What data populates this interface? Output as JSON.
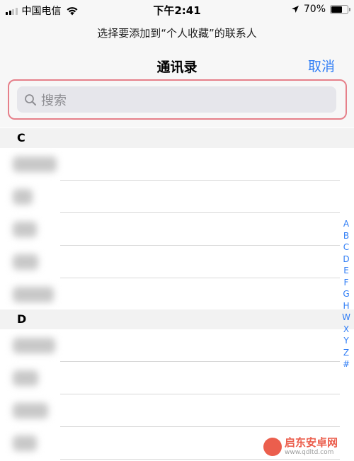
{
  "status_bar": {
    "carrier": "中国电信",
    "time": "下午2:41",
    "battery": "70%",
    "battery_level": 0.7
  },
  "header": {
    "prompt": "选择要添加到“个人收藏”的联系人",
    "title": "通讯录",
    "cancel_label": "取消"
  },
  "search": {
    "placeholder": "搜索"
  },
  "sections": [
    {
      "letter": "C",
      "rows": 5
    },
    {
      "letter": "D",
      "rows": 4
    }
  ],
  "index": [
    "A",
    "B",
    "C",
    "D",
    "E",
    "F",
    "G",
    "H",
    "W",
    "X",
    "Y",
    "Z",
    "#"
  ],
  "watermark": {
    "title": "启东安卓网",
    "url": "www.qdltd.com"
  },
  "colors": {
    "accent": "#2f7df6",
    "highlight": "#e6808a"
  }
}
